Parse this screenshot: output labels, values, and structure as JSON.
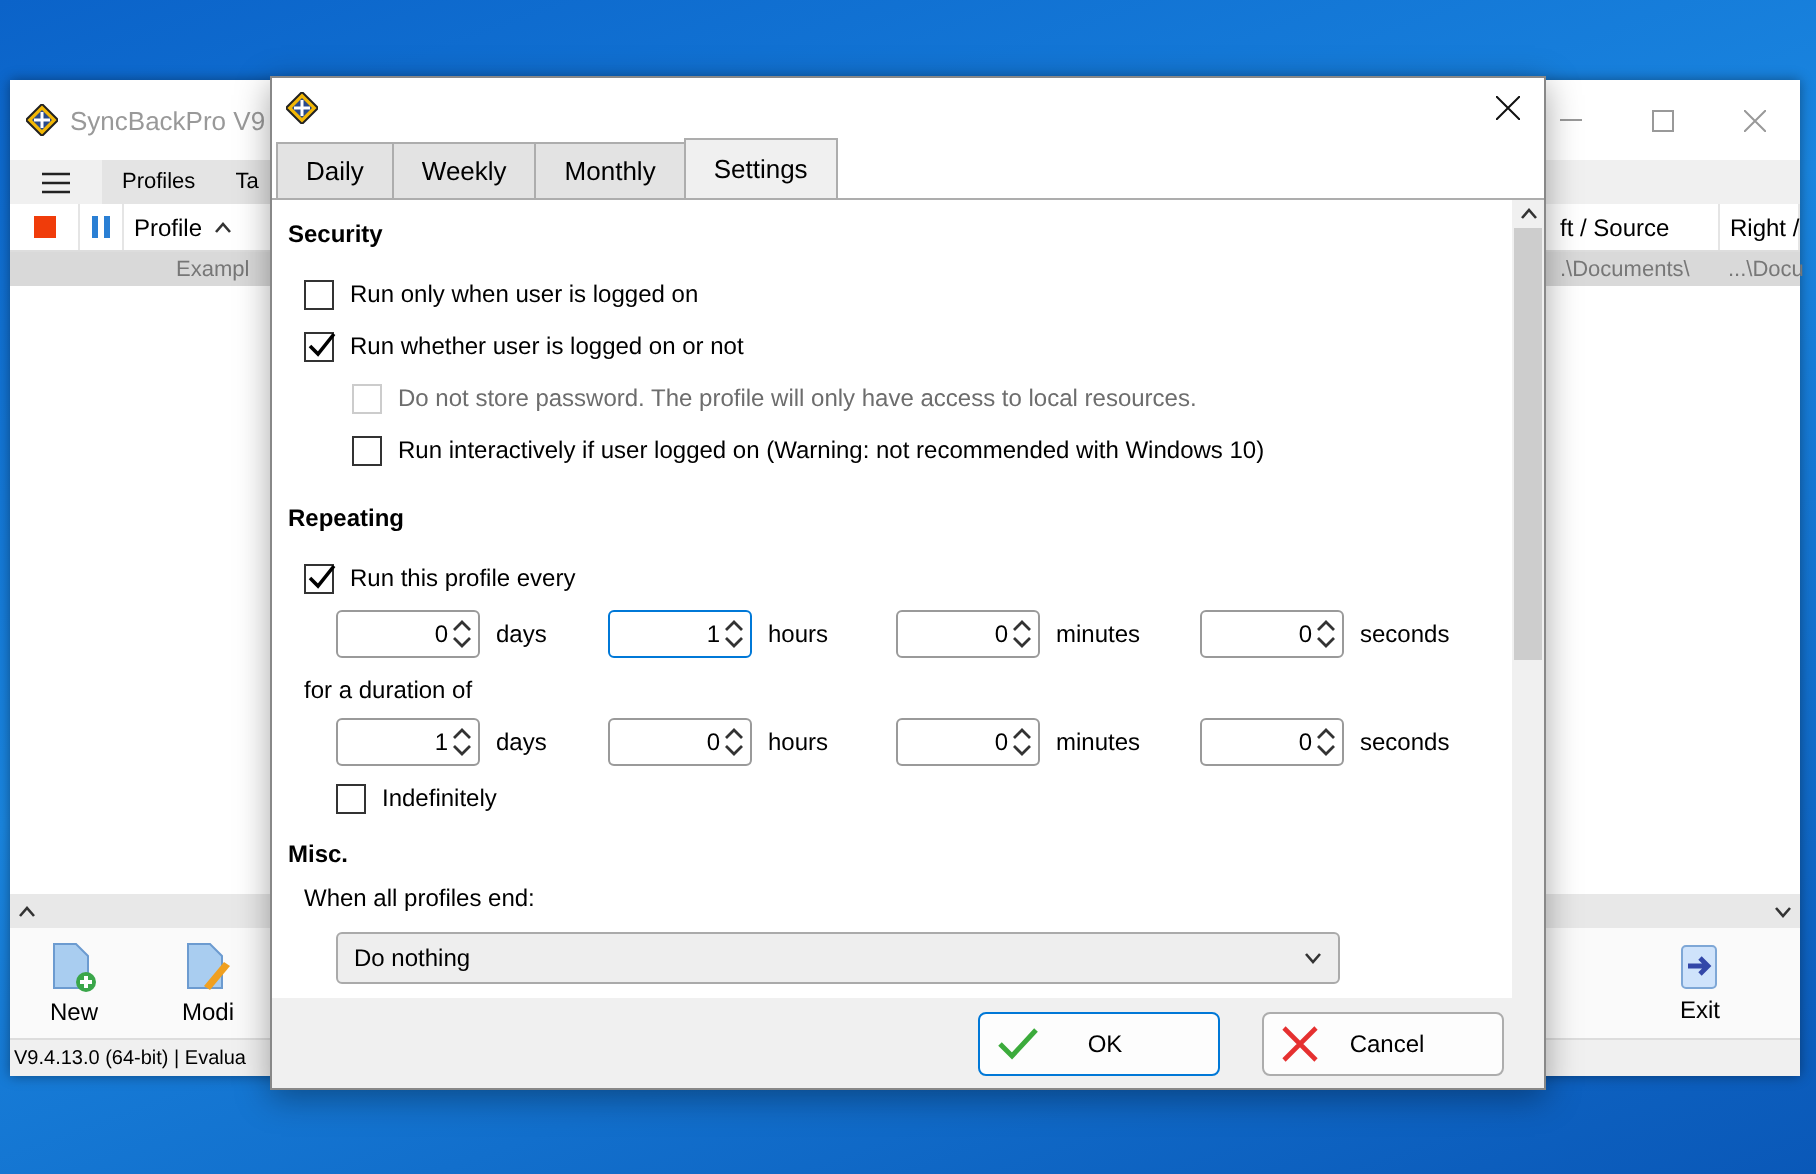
{
  "main_window": {
    "title": "SyncBackPro V9",
    "menu": [
      "Profiles",
      "Ta"
    ],
    "columns": [
      "Profile",
      "ft / Source",
      "Right / "
    ],
    "row": [
      "Exampl",
      ".\\Documents\\",
      "...\\Docu"
    ],
    "toolbar": [
      {
        "kind": "new",
        "label": "New"
      },
      {
        "kind": "modify",
        "label": "Modi"
      },
      {
        "kind": "exit",
        "label": "Exit"
      }
    ],
    "status": "V9.4.13.0 (64-bit) | Evalua"
  },
  "dialog": {
    "tabs": [
      {
        "label": "Daily",
        "selected": false
      },
      {
        "label": "Weekly",
        "selected": false
      },
      {
        "label": "Monthly",
        "selected": false
      },
      {
        "label": "Settings",
        "selected": true
      }
    ],
    "security": {
      "heading": "Security",
      "items": [
        {
          "label": "Run only when user is logged on",
          "checked": false,
          "disabled": false
        },
        {
          "label": "Run whether user is logged on or not",
          "checked": true,
          "disabled": false,
          "children": [
            {
              "label": "Do not store password. The profile will only have access to local resources.",
              "checked": false,
              "disabled": true
            },
            {
              "label": "Run interactively if user logged on (Warning: not recommended with Windows 10)",
              "checked": false,
              "disabled": false
            }
          ]
        }
      ]
    },
    "repeating": {
      "heading": "Repeating",
      "run_every": {
        "label": "Run this profile every",
        "checked": true
      },
      "every": [
        {
          "value": "0",
          "unit": "days",
          "focused": false
        },
        {
          "value": "1",
          "unit": "hours",
          "focused": true
        },
        {
          "value": "0",
          "unit": "minutes",
          "focused": false
        },
        {
          "value": "0",
          "unit": "seconds",
          "focused": false
        }
      ],
      "duration_label": "for a duration of",
      "duration": [
        {
          "value": "1",
          "unit": "days",
          "focused": false
        },
        {
          "value": "0",
          "unit": "hours",
          "focused": false
        },
        {
          "value": "0",
          "unit": "minutes",
          "focused": false
        },
        {
          "value": "0",
          "unit": "seconds",
          "focused": false
        }
      ],
      "indefinitely": {
        "label": "Indefinitely",
        "checked": false
      }
    },
    "misc": {
      "heading": "Misc.",
      "when_label": "When all profiles end:",
      "when_value": "Do nothing"
    },
    "buttons": [
      {
        "kind": "ok",
        "label": "OK"
      },
      {
        "kind": "cancel",
        "label": "Cancel"
      }
    ]
  }
}
